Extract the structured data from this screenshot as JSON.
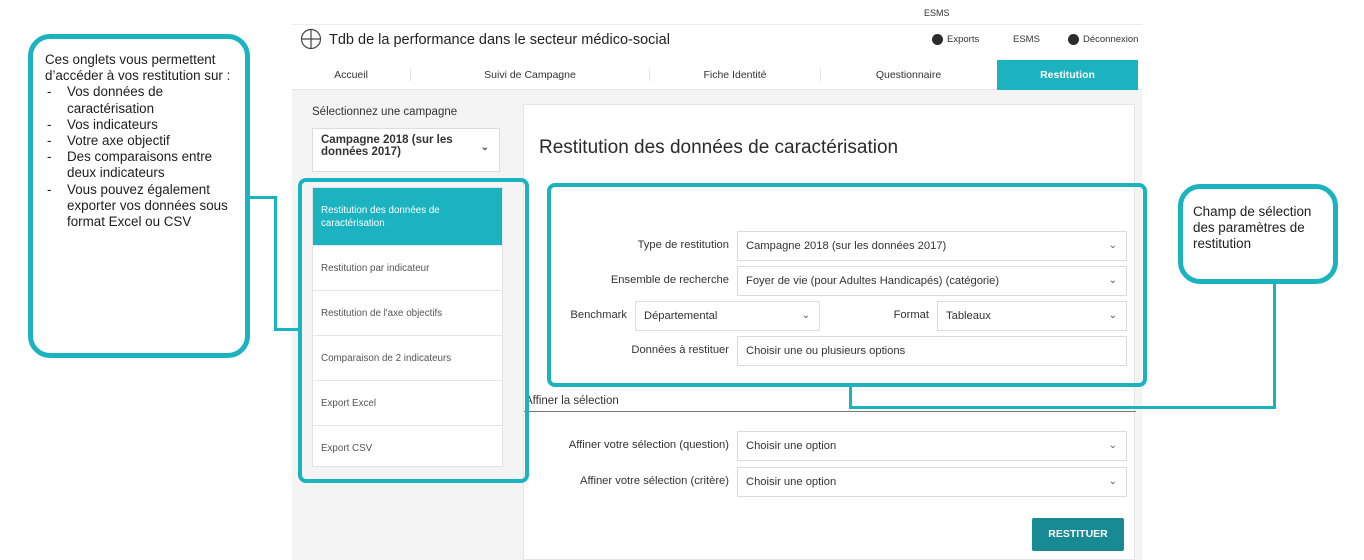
{
  "callout_left": {
    "intro": "Ces onglets vous permettent d’accéder à vos restitution sur :",
    "items": [
      "Vos données de caractérisation",
      "Vos indicateurs",
      "Votre axe objectif",
      "Des comparaisons entre deux indicateurs",
      "Vous pouvez également exporter vos données sous format Excel ou CSV"
    ]
  },
  "callout_right": {
    "text": "Champ de sélection des paramètres de restitution"
  },
  "header": {
    "top_label": "ESMS",
    "title": "Tdb de la performance dans le secteur médico-social",
    "links": {
      "exports": "Exports",
      "esms": "ESMS",
      "logout": "Déconnexion"
    }
  },
  "tabs": [
    {
      "label": "Accueil"
    },
    {
      "label": "Suivi de Campagne"
    },
    {
      "label": "Fiche Identité"
    },
    {
      "label": "Questionnaire"
    },
    {
      "label": "Restitution"
    }
  ],
  "sidebar": {
    "campaign_label": "Sélectionnez une campagne",
    "campaign_value": "Campagne 2018 (sur les données 2017)",
    "nav": [
      {
        "label": "Restitution des données de caractérisation"
      },
      {
        "label": "Restitution par indicateur"
      },
      {
        "label": "Restitution de l'axe objectifs"
      },
      {
        "label": "Comparaison de 2 indicateurs"
      },
      {
        "label": "Export Excel"
      },
      {
        "label": "Export CSV"
      }
    ]
  },
  "content": {
    "title": "Restitution des données de caractérisation",
    "type_label": "Type de restitution",
    "type_value": "Campagne 2018 (sur les données 2017)",
    "ensemble_label": "Ensemble de recherche",
    "ensemble_value": "Foyer de vie (pour Adultes Handicapés) (catégorie)",
    "benchmark_label": "Benchmark",
    "benchmark_value": "Départemental",
    "format_label": "Format",
    "format_value": "Tableaux",
    "donnees_label": "Données à restituer",
    "donnees_placeholder": "Choisir une ou plusieurs options",
    "refine_title": "Affiner la sélection",
    "refine_question_label": "Affiner votre sélection (question)",
    "refine_question_value": "Choisir une option",
    "refine_critere_label": "Affiner votre sélection (critère)",
    "refine_critere_value": "Choisir une option",
    "submit_label": "RESTITUER"
  },
  "colors": {
    "accent": "#1ab3bf",
    "button": "#178a94"
  }
}
